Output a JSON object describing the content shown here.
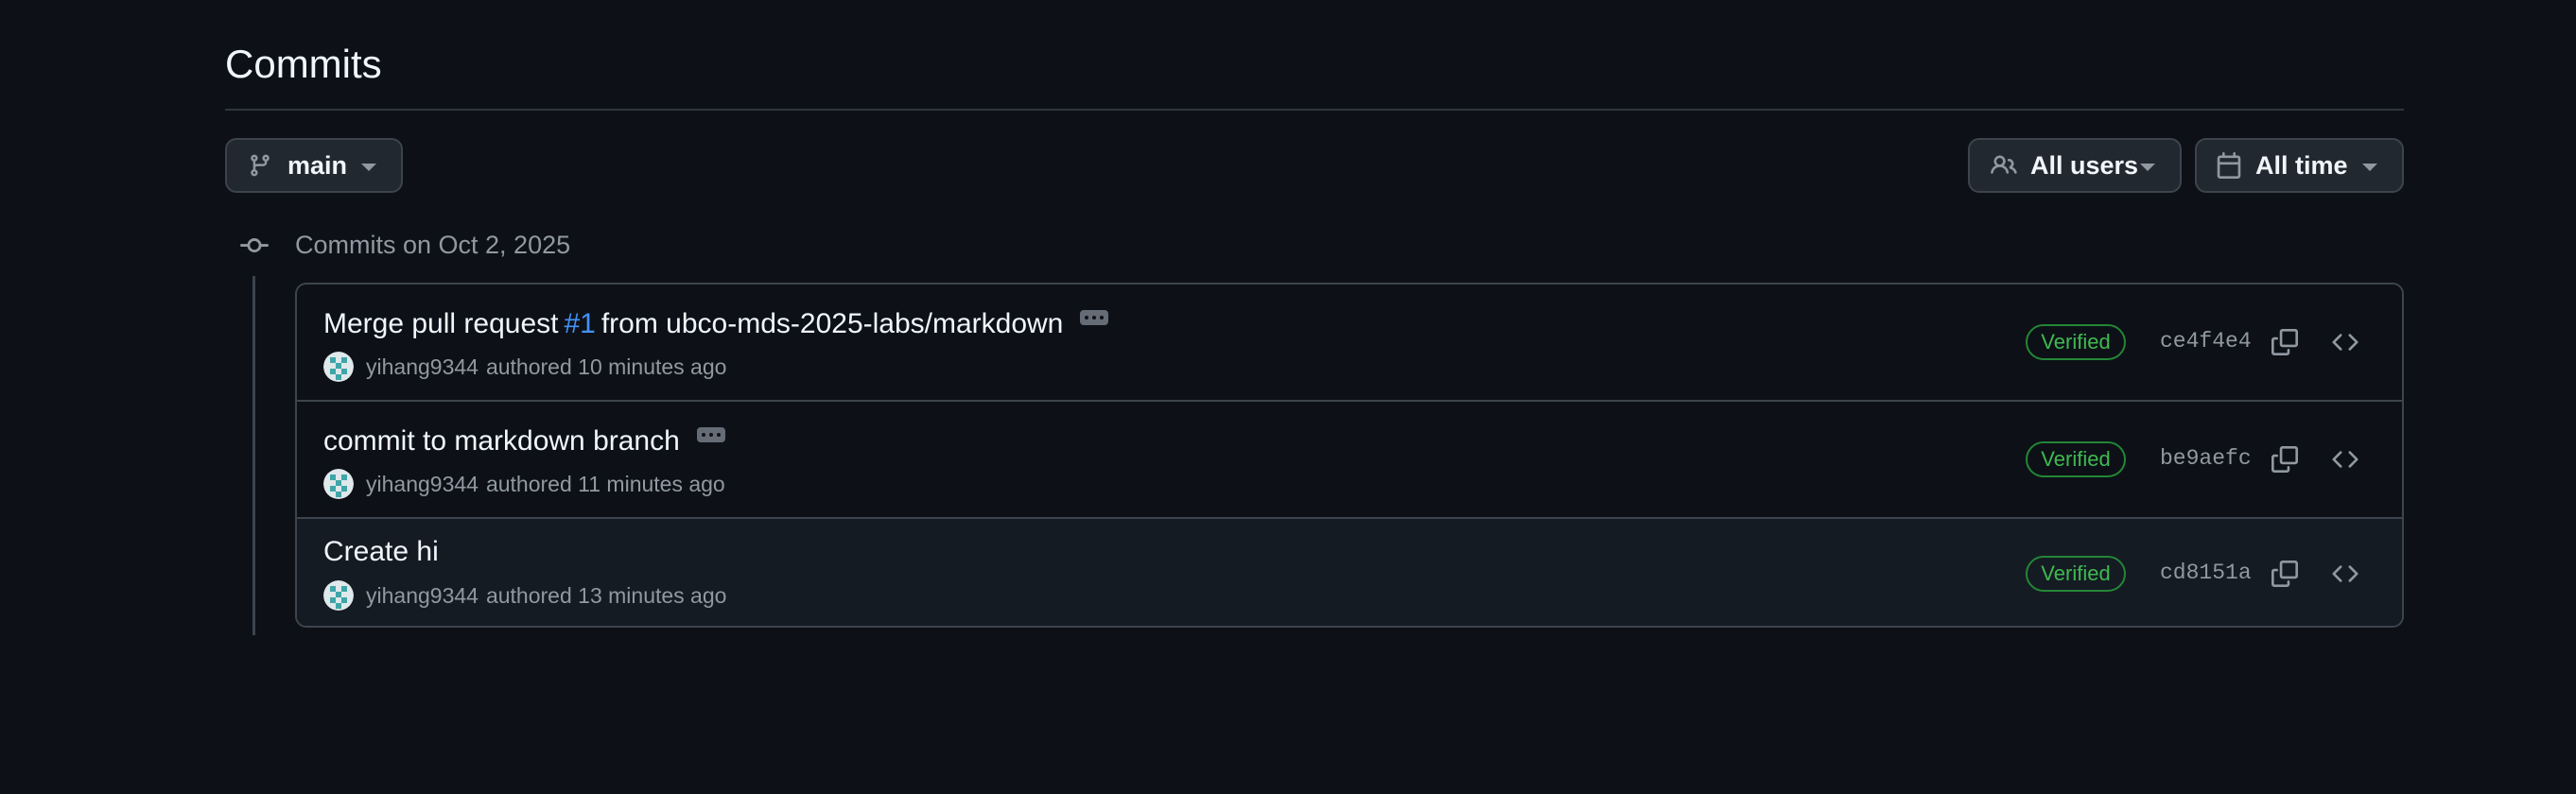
{
  "page": {
    "title": "Commits"
  },
  "toolbar": {
    "branch_label": "main",
    "users_label": "All users",
    "time_label": "All time"
  },
  "commit_group": {
    "heading": "Commits on Oct 2, 2025"
  },
  "commits": [
    {
      "title_prefix": "Merge pull request",
      "pr_ref": "#1",
      "title_suffix": "from ubco-mds-2025-labs/markdown",
      "has_expand": true,
      "author": "yihang9344",
      "authored_text": "authored",
      "time_ago": "10 minutes ago",
      "verified_label": "Verified",
      "sha": "ce4f4e4"
    },
    {
      "title_prefix": "commit to markdown branch",
      "pr_ref": "",
      "title_suffix": "",
      "has_expand": true,
      "author": "yihang9344",
      "authored_text": "authored",
      "time_ago": "11 minutes ago",
      "verified_label": "Verified",
      "sha": "be9aefc"
    },
    {
      "title_prefix": "Create hi",
      "pr_ref": "",
      "title_suffix": "",
      "has_expand": false,
      "author": "yihang9344",
      "authored_text": "authored",
      "time_ago": "13 minutes ago",
      "verified_label": "Verified",
      "sha": "cd8151a"
    }
  ],
  "icons": {
    "branch": "git-branch-icon",
    "users": "people-icon",
    "calendar": "calendar-icon",
    "caret": "caret-down-icon",
    "timeline": "git-commit-icon",
    "ellipsis": "ellipsis-icon",
    "copy": "copy-icon",
    "browse": "code-icon"
  },
  "colors": {
    "background": "#0d1117",
    "accent_link": "#4493f8",
    "verified": "#3fb950",
    "border": "#3d444d"
  }
}
